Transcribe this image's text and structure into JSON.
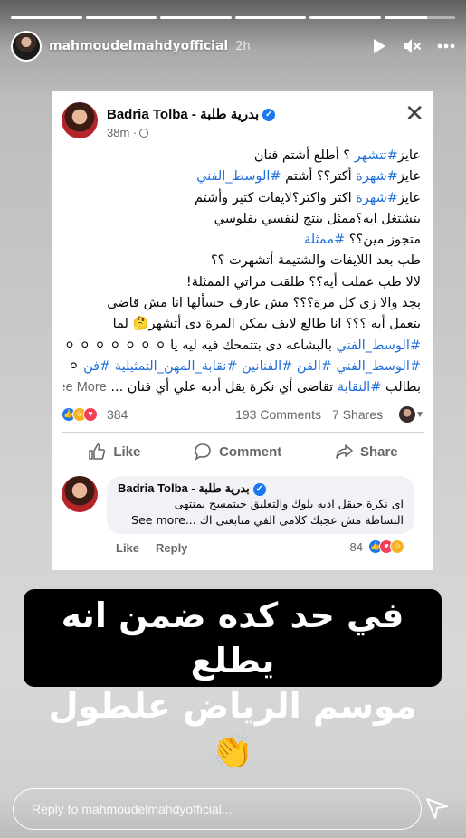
{
  "story": {
    "segments": [
      {
        "progress": 1
      },
      {
        "progress": 1
      },
      {
        "progress": 1
      },
      {
        "progress": 1
      },
      {
        "progress": 1
      },
      {
        "progress": 0.6
      }
    ],
    "username": "mahmoudelmahdyofficial",
    "time": "2h",
    "icons": [
      "play-icon",
      "mute-icon",
      "more-icon"
    ]
  },
  "post": {
    "author": "Badria Tolba - بدرية طلبة",
    "time": "38m ·",
    "lines": [
      [
        {
          "t": "عايز"
        },
        {
          "t": "#تتشهر",
          "h": true
        },
        {
          "t": " ؟ أطلع أشتم فنان"
        }
      ],
      [
        {
          "t": "عايز"
        },
        {
          "t": "#شهرة",
          "h": true
        },
        {
          "t": " أكتر؟؟ أشتم "
        },
        {
          "t": "#الوسط_الفني",
          "h": true
        }
      ],
      [
        {
          "t": "عايز"
        },
        {
          "t": "#شهرة",
          "h": true
        },
        {
          "t": " اكتر واكتر؟لايفات كتير وأشتم"
        }
      ],
      [
        {
          "t": "بتشتغل ايه؟ممثل بنتج لنفسي بفلوسي"
        }
      ],
      [
        {
          "t": "متجوز مين؟؟ "
        },
        {
          "t": "#ممثلة",
          "h": true
        }
      ],
      [
        {
          "t": "طب بعد اللايفات والشتيمة أتشهرت ؟؟"
        }
      ],
      [
        {
          "t": "لالا طب عملت أيه؟؟ طلقت مراتي الممثلة!"
        }
      ],
      [
        {
          "t": "بجد والا زى كل مرة؟؟؟ مش عارف حسألها  انا مش قاضى"
        }
      ],
      [
        {
          "t": "بتعمل أيه ؟؟؟ انا طالع لايف يمكن المرة دى أتشهر🤔 لما"
        }
      ],
      [
        {
          "t": "#الوسط_الفني",
          "h": true
        },
        {
          "t": " بالبشاعه دى بتتمحك فيه ليه يا ⚪ ⚪ ⚪ ⚪ ⚪ ⚪ ⚪"
        }
      ],
      [
        {
          "t": "#الوسط_الفني",
          "h": true
        },
        {
          "t": " "
        },
        {
          "t": "#الفن",
          "h": true
        },
        {
          "t": " "
        },
        {
          "t": "#الفنانين",
          "h": true
        },
        {
          "t": " "
        },
        {
          "t": "#نقابة_المهن_التمثيلية",
          "h": true
        },
        {
          "t": " "
        },
        {
          "t": "#فن",
          "h": true
        },
        {
          "t": " ⚪"
        }
      ],
      [
        {
          "t": "بطالب "
        },
        {
          "t": "#النقابة",
          "h": true
        },
        {
          "t": " تقاضى أي نكرة يقل أدبه علي أي فنان ... "
        },
        {
          "t": "See More",
          "m": true
        }
      ]
    ],
    "reaction_count": "384",
    "comments": "193 Comments",
    "shares": "7 Shares",
    "actions": {
      "like": "Like",
      "comment": "Comment",
      "share": "Share"
    }
  },
  "comment": {
    "author": "Badria Tolba - بدرية طلبة",
    "line1": "اى نكرة حيقل ادبه بلوك والتعليق حيتمسح بمنتهى",
    "line2": "البساطة مش عجبك كلامى الفي متابعتى اك ...See more",
    "like": "Like",
    "reply": "Reply",
    "count": "84"
  },
  "overlay": {
    "line1": "في حد كده ضمن انه يطلع",
    "line2": "موسم الرياض علطول 👏"
  },
  "reply_bar": {
    "placeholder": "Reply to mahmoudelmahdyofficial..."
  },
  "colors": {
    "hashtag": "#216fdb",
    "fb_blue": "#1877f2"
  }
}
